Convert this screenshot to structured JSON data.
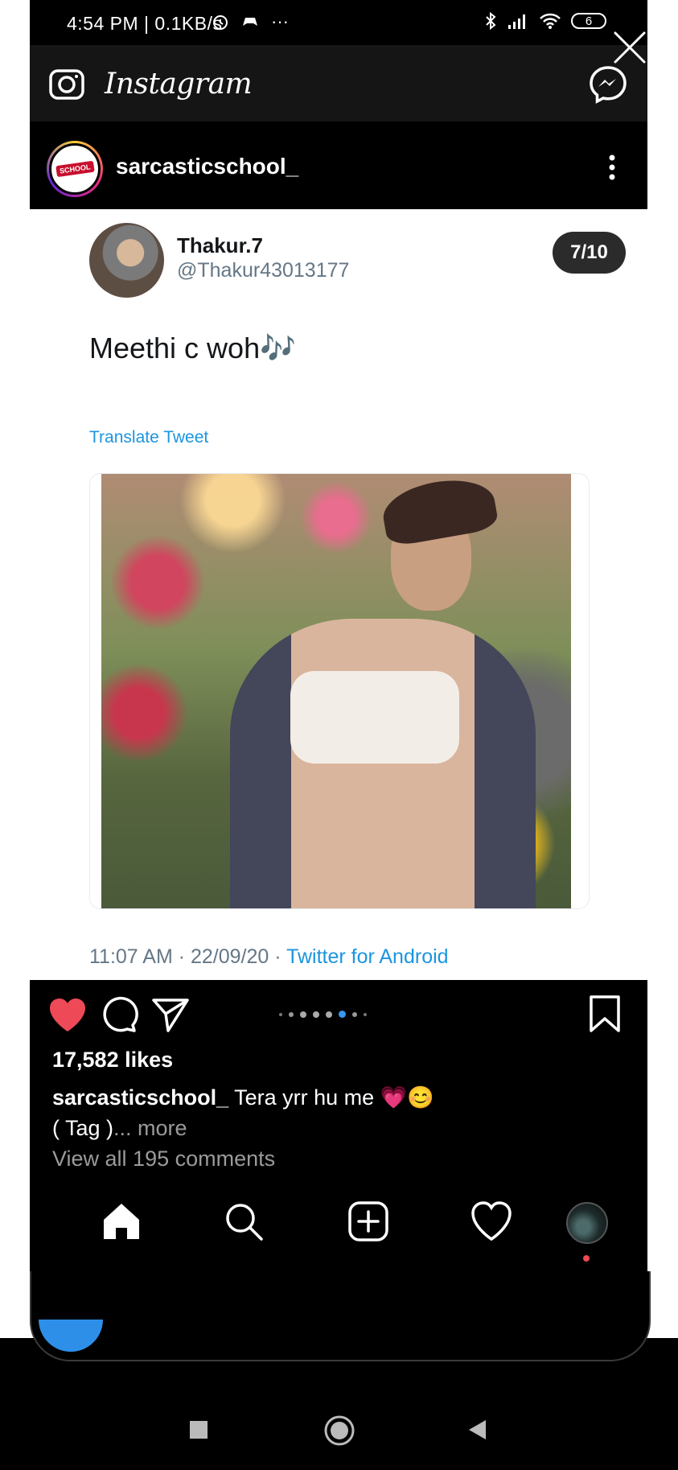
{
  "status_bar": {
    "time": "4:54 PM | 0.1KB/s",
    "battery": "6",
    "more": "···"
  },
  "ig_header": {
    "logo": "Instagram",
    "camera_icon": "camera-icon",
    "messenger_icon": "messenger-icon"
  },
  "post": {
    "account_name": "sarcasticschool_",
    "account_badge": "SCHOOL",
    "slide_counter": "7/10"
  },
  "tweet": {
    "display_name": "Thakur.7",
    "handle": "@Thakur43013177",
    "text": "Meethi c woh🎶",
    "translate": "Translate Tweet",
    "meta_time": "11:07 AM · 22/09/20 · ",
    "meta_source": "Twitter for Android"
  },
  "engagement": {
    "likes": "17,582 likes",
    "caption_user": "sarcasticschool_",
    "caption_text": " Tera yrr hu me 💗😊",
    "caption_line2": "( Tag )",
    "caption_more": "... more",
    "view_comments": "View all 195 comments"
  },
  "carousel": {
    "total_dots": 9,
    "active_dot": 6
  },
  "colors": {
    "like": "#ed4956",
    "link": "#1b95e0",
    "active_dot": "#3897f0"
  }
}
